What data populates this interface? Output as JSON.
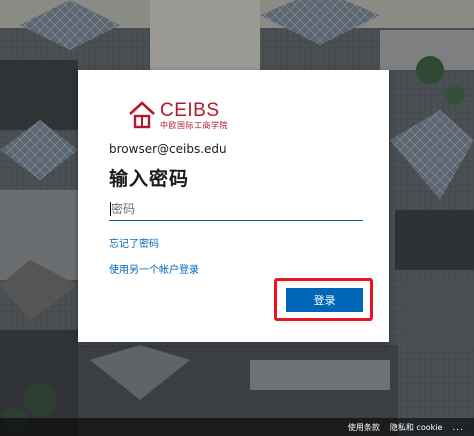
{
  "brand": {
    "name": "CEIBS",
    "subtitle": "中欧国际工商学院",
    "color": "#b3182b"
  },
  "account": {
    "email": "browser@ceibs.edu"
  },
  "form": {
    "heading": "输入密码",
    "password_placeholder": "密码",
    "password_value": "",
    "forgot_link": "忘记了密码",
    "other_account_link": "使用另一个帐户登录",
    "signin_label": "登录"
  },
  "footer": {
    "terms": "使用条款",
    "privacy": "隐私和 cookie",
    "more": "..."
  },
  "colors": {
    "accent": "#0067b8",
    "highlight": "#e8141e"
  }
}
